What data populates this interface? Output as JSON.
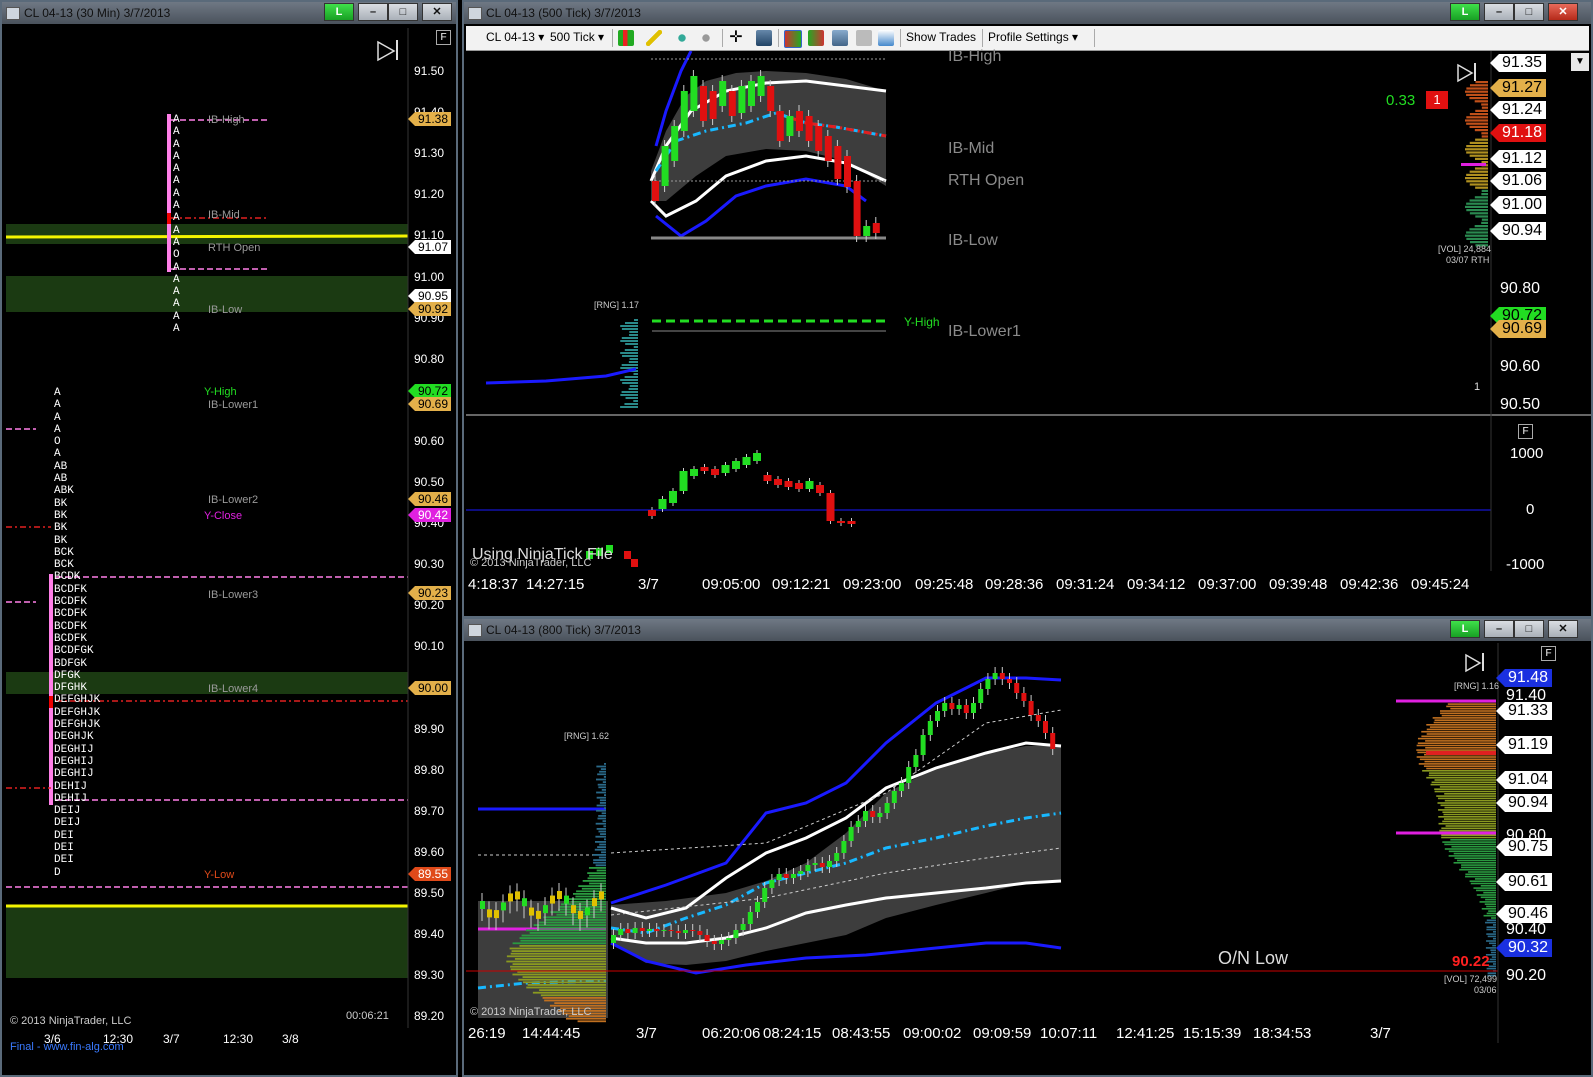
{
  "left": {
    "title": "CL 04-13 (30 Min)  3/7/2013",
    "link": "L",
    "price_labels": [
      "91.50",
      "91.40",
      "91.30",
      "91.20",
      "91.10",
      "91.00",
      "90.90",
      "90.80",
      "90.70",
      "90.60",
      "90.50",
      "90.40",
      "90.30",
      "90.20",
      "90.10",
      "90.00",
      "89.90",
      "89.80",
      "89.70",
      "89.60",
      "89.50",
      "89.40",
      "89.30",
      "89.20"
    ],
    "tags": {
      "t1": "91.38",
      "t2": "91.07",
      "t3": "90.95",
      "t4": "90.92",
      "t5": "90.72",
      "t6": "90.69",
      "t7": "90.46",
      "t8": "90.42",
      "t9": "90.23",
      "t10": "90.00",
      "t11": "89.55"
    },
    "levels": {
      "ib_high": "IB-High",
      "ib_mid": "IB-Mid",
      "rth_open": "RTH Open",
      "ib_low": "IB-Low",
      "y_high": "Y-High",
      "ib_lower1": "IB-Lower1",
      "ib_lower2": "IB-Lower2",
      "y_close": "Y-Close",
      "ib_lower3": "IB-Lower3",
      "ib_lower4": "IB-Lower4",
      "y_low": "Y-Low"
    },
    "tpo_top": "A\nA\nA\nA\nA\nA\nA\nA\nA\nA\nA\nO\nA\nA\nA\nA\nA\nA",
    "tpo_bottom": "A\nA\nA\nA\nO\nA\nAB\nAB\nABK\nBK\nBK\nBK\nBK\nBCK\nBCK\nBCDK\nBCDFK\nBCDFK\nBCDFK\nBCDFK\nBCDFK\nBCDFGK\nBDFGK\nDFGK\nDFGHK\nDEFGHJK\nDEFGHJK\nDEFGHJK\nDEGHJK\nDEGHIJ\nDEGHIJ\nDEGHIJ\nDEHIJ\nDEHIJ\nDEIJ\nDEIJ\nDEI\nDEI\nDEI\nD",
    "copyright": "© 2013 NinjaTrader, LLC",
    "footer_link": "Final - www.fin-alg.com",
    "timer": "00:06:21",
    "x_labels": [
      "3/6",
      "12:30",
      "3/7",
      "12:30",
      "3/8"
    ],
    "f_button": "F"
  },
  "top": {
    "title": "CL 04-13 (500 Tick)  3/7/2013",
    "link": "L",
    "instrument": "CL 04-13",
    "period": "500 Tick",
    "show_trades": "Show Trades",
    "profile_settings": "Profile Settings",
    "price_labels": [
      "91.35",
      "91.27",
      "91.24",
      "91.18",
      "91.12",
      "91.06",
      "91.00",
      "90.94",
      "90.80",
      "90.72",
      "90.69",
      "90.60",
      "90.50"
    ],
    "levels": {
      "ib_high": "IB-High",
      "ib_mid": "IB-Mid",
      "rth_open": "RTH Open",
      "ib_low": "IB-Low",
      "ib_lower1": "IB-Lower1",
      "y_high": "Y-High"
    },
    "green_num": "0.33",
    "red_box": "1",
    "vol_text": "[VOL] 24,884",
    "vol_date": "03/07 RTH",
    "rng_text": "[RNG] 1.17",
    "one": "1",
    "osc_labels": [
      "1000",
      "0",
      "-1000"
    ],
    "using_file": "Using NinjaTick File",
    "copyright": "© 2013 NinjaTrader, LLC",
    "x_labels": [
      "4:18:37",
      "14:27:15",
      "3/7",
      "09:05:00",
      "09:12:21",
      "09:23:00",
      "09:25:48",
      "09:28:36",
      "09:31:24",
      "09:34:12",
      "09:37:00",
      "09:39:48",
      "09:42:36",
      "09:45:24"
    ],
    "f_button": "F"
  },
  "bottom": {
    "title": "CL 04-13 (800 Tick)  3/7/2013",
    "link": "L",
    "price_labels": [
      "91.48",
      "91.40",
      "91.33",
      "91.19",
      "91.04",
      "90.94",
      "90.80",
      "90.75",
      "90.61",
      "90.46",
      "90.40",
      "90.32",
      "90.22",
      "90.20"
    ],
    "rng_left": "[RNG] 1.62",
    "rng_right": "[RNG] 1.16",
    "on_low": "O/N Low",
    "low_val": "90.22",
    "vol_text": "[VOL] 72,499",
    "vol_date": "03/06",
    "copyright": "© 2013 NinjaTrader, LLC",
    "x_labels": [
      "26:19",
      "14:44:45",
      "3/7",
      "06:20:06",
      "08:24:15",
      "08:43:55",
      "09:00:02",
      "09:09:59",
      "10:07:11",
      "12:41:25",
      "15:15:39",
      "18:34:53",
      "3/7"
    ],
    "f_button": "F"
  }
}
